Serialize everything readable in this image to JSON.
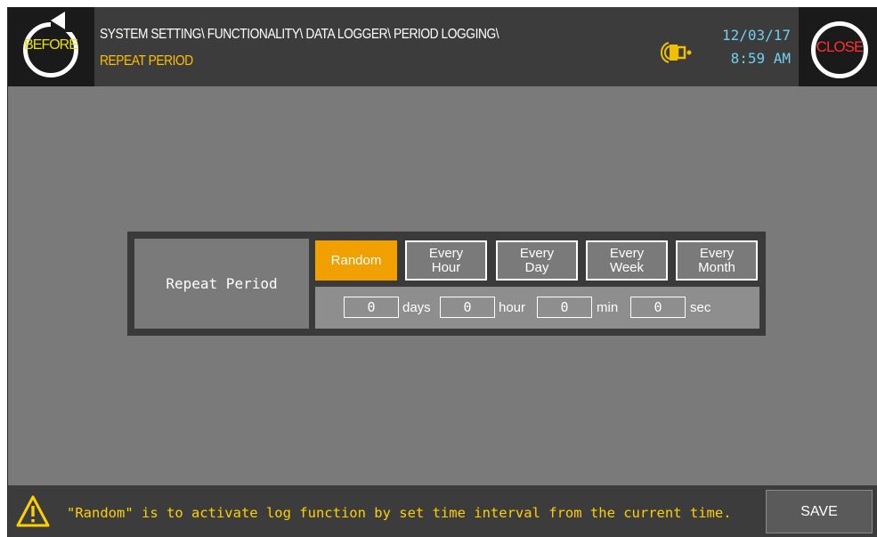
{
  "header": {
    "before_label": "BEFORE",
    "close_label": "CLOSE",
    "path": "SYSTEM SETTING\\ FUNCTIONALITY\\ DATA LOGGER\\ PERIOD LOGGING\\",
    "page_title": "REPEAT PERIOD",
    "date": "12/03/17",
    "time": "8:59 AM",
    "alarm_icon": "alarm-bell-icon"
  },
  "panel": {
    "label": "Repeat Period",
    "modes": [
      {
        "line1": "Random",
        "line2": "",
        "active": true
      },
      {
        "line1": "Every",
        "line2": "Hour",
        "active": false
      },
      {
        "line1": "Every",
        "line2": "Day",
        "active": false
      },
      {
        "line1": "Every",
        "line2": "Week",
        "active": false
      },
      {
        "line1": "Every",
        "line2": "Month",
        "active": false
      }
    ],
    "fields": [
      {
        "value": "0",
        "unit": "days"
      },
      {
        "value": "0",
        "unit": "hour"
      },
      {
        "value": "0",
        "unit": "min"
      },
      {
        "value": "0",
        "unit": "sec"
      }
    ]
  },
  "footer": {
    "message": "\"Random\" is to activate log function by set time interval from the current time.",
    "save_label": "SAVE",
    "warning_icon": "warning-triangle-icon"
  },
  "colors": {
    "active_mode": "#f0a000",
    "title_accent": "#ffc000",
    "clock": "#6fd0f0",
    "close": "#ff3030",
    "before": "#e8e000"
  }
}
